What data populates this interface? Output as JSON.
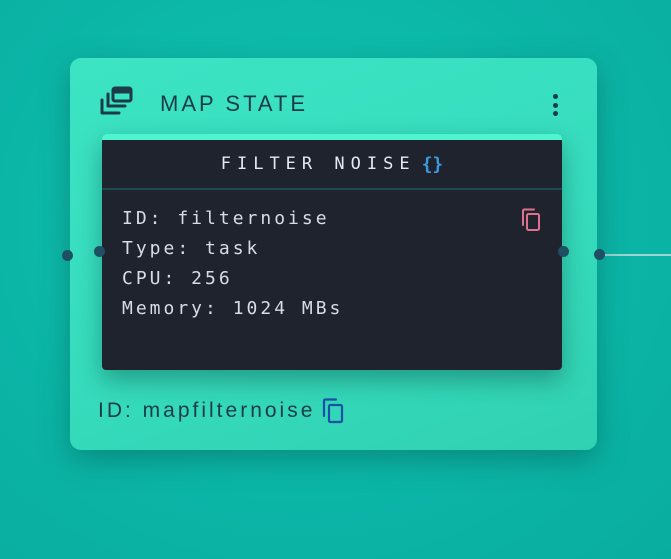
{
  "map_node": {
    "title": "MAP STATE",
    "icon": "stacked-windows-icon",
    "menu_icon": "kebab-menu-icon",
    "id_label": "ID: mapfilternoise",
    "copy_icon": "copy-icon",
    "copy_icon_color": "#1a4fa8"
  },
  "task_node": {
    "title": "FILTER NOISE",
    "title_icon": "{}",
    "title_icon_color": "#3b9be0",
    "accent_color": "#4ff5cf",
    "copy_icon": "copy-icon",
    "copy_icon_color": "#e0708f",
    "lines": {
      "id": "ID: filternoise",
      "type": "Type: task",
      "cpu": "CPU: 256",
      "memory": "Memory: 1024 MBs"
    }
  },
  "colors": {
    "canvas_background": "#0cb8a8",
    "map_node_background": "#36dcbd",
    "task_card_background": "#1f232e",
    "handle": "#1f4f63",
    "edge": "#9ad6cf"
  }
}
